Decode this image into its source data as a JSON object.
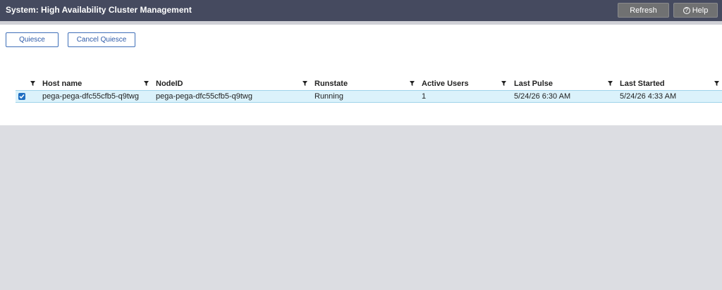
{
  "header": {
    "title": "System: High Availability Cluster Management",
    "refresh_label": "Refresh",
    "help_label": "Help"
  },
  "actions": {
    "quiesce_label": "Quiesce",
    "cancel_quiesce_label": "Cancel Quiesce"
  },
  "table": {
    "columns": [
      "Host name",
      "NodeID",
      "Runstate",
      "Active Users",
      "Last Pulse",
      "Last Started"
    ],
    "rows": [
      {
        "selected": true,
        "cells": [
          "pega-pega-dfc55cfb5-q9twg",
          "pega-pega-dfc55cfb5-q9twg",
          "Running",
          "1",
          "5/24/26 6:30 AM",
          "5/24/26 4:33 AM"
        ]
      }
    ]
  },
  "colors": {
    "header_bg": "#454a5f",
    "row_highlight": "#dbf2fb",
    "accent_blue": "#2d5aa8",
    "checkbox_blue": "#1f6fc2"
  }
}
